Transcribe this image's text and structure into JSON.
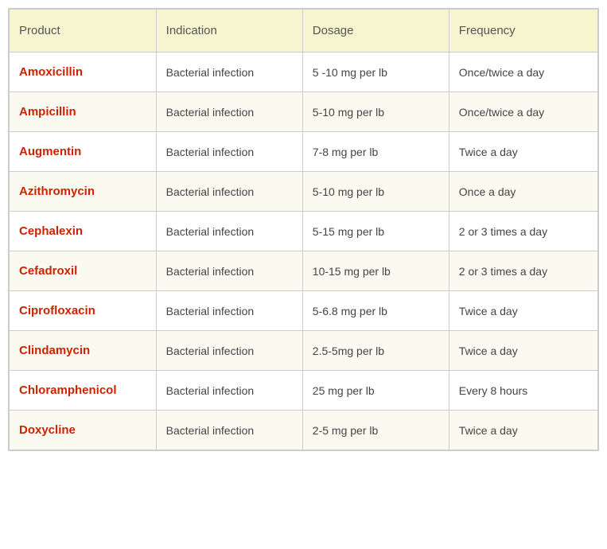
{
  "table": {
    "headers": {
      "product": "Product",
      "indication": "Indication",
      "dosage": "Dosage",
      "frequency": "Frequency"
    },
    "rows": [
      {
        "product": "Amoxicillin",
        "indication": "Bacterial infection",
        "dosage": "5 -10 mg per lb",
        "frequency": "Once/twice a day"
      },
      {
        "product": "Ampicillin",
        "indication": "Bacterial infection",
        "dosage": "5-10 mg per lb",
        "frequency": "Once/twice a day"
      },
      {
        "product": "Augmentin",
        "indication": "Bacterial infection",
        "dosage": "7-8 mg per lb",
        "frequency": "Twice a day"
      },
      {
        "product": "Azithromycin",
        "indication": "Bacterial infection",
        "dosage": "5-10 mg per lb",
        "frequency": "Once a day"
      },
      {
        "product": "Cephalexin",
        "indication": "Bacterial infection",
        "dosage": "5-15 mg per lb",
        "frequency": "2 or 3 times a day"
      },
      {
        "product": "Cefadroxil",
        "indication": "Bacterial infection",
        "dosage": "10-15 mg per lb",
        "frequency": "2 or 3 times a day"
      },
      {
        "product": "Ciprofloxacin",
        "indication": "Bacterial infection",
        "dosage": "5-6.8 mg per lb",
        "frequency": "Twice a day"
      },
      {
        "product": "Clindamycin",
        "indication": "Bacterial infection",
        "dosage": "2.5-5mg per lb",
        "frequency": "Twice a day"
      },
      {
        "product": "Chloramphenicol",
        "indication": "Bacterial infection",
        "dosage": "25 mg per lb",
        "frequency": "Every 8 hours"
      },
      {
        "product": "Doxycline",
        "indication": "Bacterial infection",
        "dosage": "2-5 mg per lb",
        "frequency": "Twice a day"
      }
    ]
  }
}
